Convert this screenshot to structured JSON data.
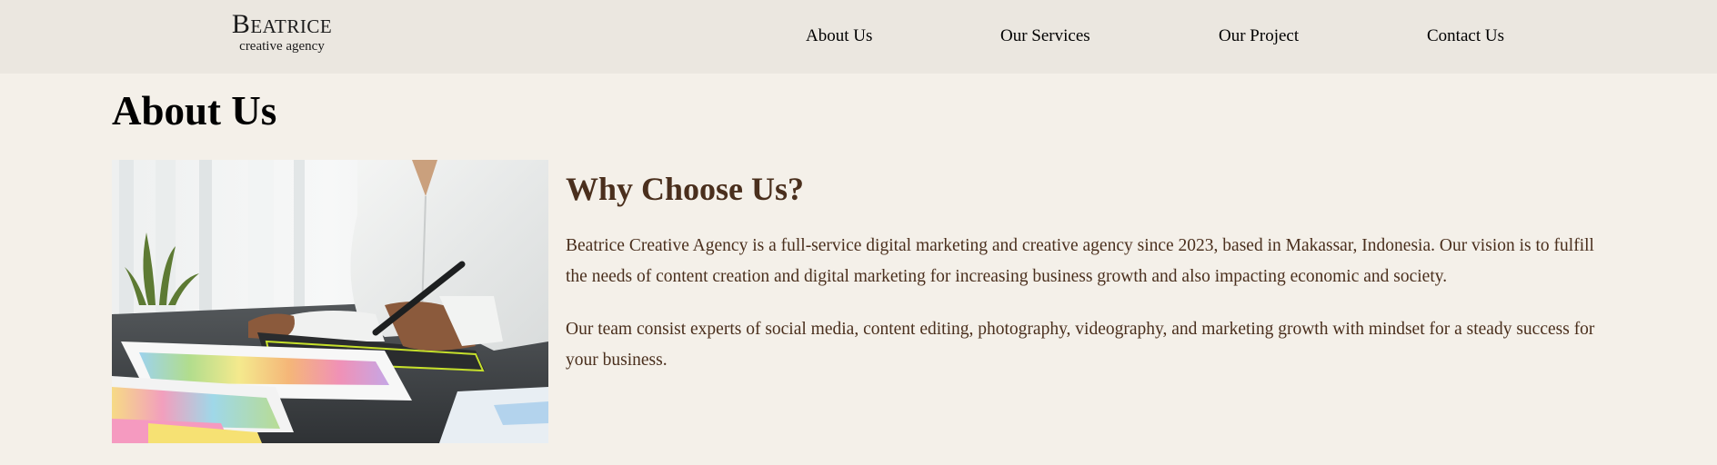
{
  "brand": {
    "name": "Beatrice",
    "tagline": "creative agency"
  },
  "nav": {
    "items": [
      "About Us",
      "Our Services",
      "Our Project",
      "Contact Us"
    ]
  },
  "about": {
    "title": "About Us",
    "heading": "Why Choose Us?",
    "paragraphs": [
      "Beatrice Creative Agency is a full-service digital marketing and creative agency since 2023, based in Makassar, Indonesia. Our vision is to fulfill the needs of content creation and digital marketing for increasing business growth and also impacting economic and society.",
      "Our team consist experts of social media, content editing, photography, videography, and marketing growth with mindset for a steady success for your business."
    ]
  },
  "colors": {
    "header_bg": "#ebe7e0",
    "page_bg": "#f4f0e9",
    "accent_brown": "#4a2f1d"
  },
  "icons": {
    "photo": "designer-with-color-swatches-image"
  }
}
